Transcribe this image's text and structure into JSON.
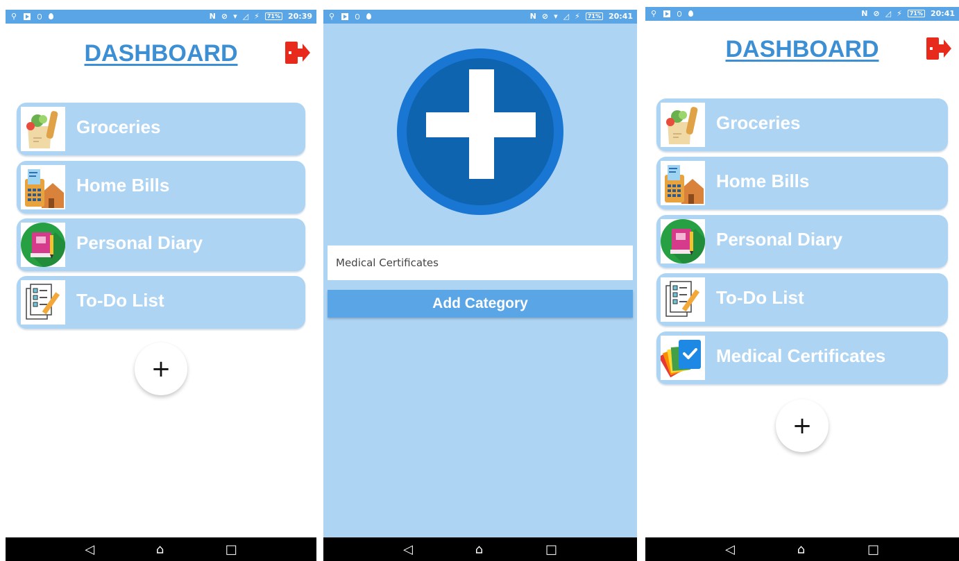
{
  "screens": [
    {
      "status": {
        "time": "20:39",
        "battery": "71%"
      },
      "title": "DASHBOARD",
      "categories": [
        {
          "label": "Groceries",
          "icon": "grocery-bag-icon"
        },
        {
          "label": "Home Bills",
          "icon": "calculator-house-icon"
        },
        {
          "label": "Personal Diary",
          "icon": "diary-book-icon"
        },
        {
          "label": "To-Do List",
          "icon": "checklist-icon"
        }
      ],
      "fab_label": "+"
    },
    {
      "status": {
        "time": "20:41",
        "battery": "71%"
      },
      "input_value": "Medical Certificates",
      "button_label": "Add Category"
    },
    {
      "status": {
        "time": "20:41",
        "battery": "71%"
      },
      "title": "DASHBOARD",
      "categories": [
        {
          "label": "Groceries",
          "icon": "grocery-bag-icon"
        },
        {
          "label": "Home Bills",
          "icon": "calculator-house-icon"
        },
        {
          "label": "Personal Diary",
          "icon": "diary-book-icon"
        },
        {
          "label": "To-Do List",
          "icon": "checklist-icon"
        },
        {
          "label": "Medical Certificates",
          "icon": "certificate-cards-icon"
        }
      ],
      "fab_label": "+"
    }
  ],
  "navbar": {
    "back": "◁",
    "home": "⌂",
    "recents": "□"
  },
  "colors": {
    "accent": "#5aa5e6",
    "card": "#aed4f3",
    "title": "#3d8fd4",
    "logout": "#e82a1c",
    "plus_circle": "#1976d2"
  }
}
